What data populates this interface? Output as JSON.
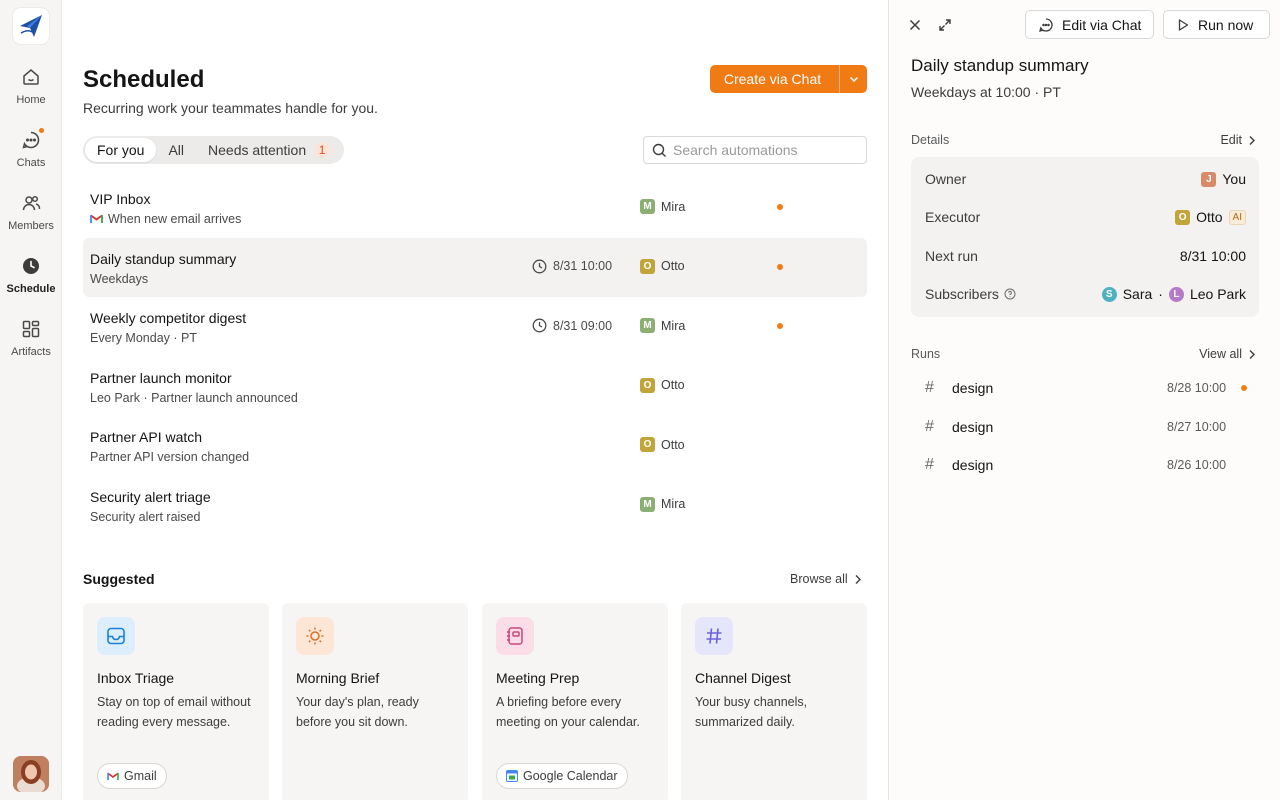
{
  "nav": {
    "items": [
      {
        "label": "Home",
        "icon": "home-icon"
      },
      {
        "label": "Chats",
        "icon": "chat-icon"
      },
      {
        "label": "Members",
        "icon": "members-icon"
      },
      {
        "label": "Schedule",
        "icon": "clock-icon"
      },
      {
        "label": "Artifacts",
        "icon": "artifacts-icon"
      }
    ],
    "active": "Schedule"
  },
  "header": {
    "title": "Scheduled",
    "subtitle": "Recurring work your teammates handle for you.",
    "create_label": "Create via Chat"
  },
  "tabs": [
    {
      "label": "For you"
    },
    {
      "label": "All"
    },
    {
      "label": "Needs attention",
      "count": "1"
    }
  ],
  "search": {
    "placeholder": "Search automations"
  },
  "automations": [
    {
      "name": "VIP Inbox",
      "desc": "When new email arrives",
      "time": "",
      "person": "Mira",
      "initial": "M",
      "dot": true
    },
    {
      "name": "Daily standup summary",
      "desc": "Weekdays",
      "time": "8/31 10:00",
      "person": "Otto",
      "initial": "O",
      "dot": true
    },
    {
      "name": "Weekly competitor digest",
      "desc": "Every Monday · PT",
      "time": "8/31 09:00",
      "person": "Mira",
      "initial": "M",
      "dot": true
    },
    {
      "name": "Partner launch monitor",
      "desc": "Leo Park · Partner launch announced",
      "time": "",
      "person": "Otto",
      "initial": "O",
      "dot": false
    },
    {
      "name": "Partner API watch",
      "desc": "Partner API version changed",
      "time": "",
      "person": "Otto",
      "initial": "O",
      "dot": false
    },
    {
      "name": "Security alert triage",
      "desc": "Security alert raised",
      "time": "",
      "person": "Mira",
      "initial": "M",
      "dot": false
    }
  ],
  "suggested": {
    "title": "Suggested",
    "browse_label": "Browse all",
    "cards": [
      {
        "title": "Inbox Triage",
        "desc": "Stay on top of email without reading every message.",
        "chip": "Gmail"
      },
      {
        "title": "Morning Brief",
        "desc": "Your day's plan, ready before you sit down.",
        "chip": ""
      },
      {
        "title": "Meeting Prep",
        "desc": "A briefing before every meeting on your calendar.",
        "chip": "Google Calendar"
      },
      {
        "title": "Channel Digest",
        "desc": "Your busy channels, summarized daily.",
        "chip": ""
      }
    ]
  },
  "panel": {
    "edit_chat_label": "Edit via Chat",
    "run_now_label": "Run now",
    "title": "Daily standup summary",
    "subtitle": "Weekdays at 10:00 · PT",
    "details_label": "Details",
    "edit_label": "Edit",
    "details": {
      "owner_key": "Owner",
      "owner_initial": "J",
      "owner_val": "You",
      "executor_key": "Executor",
      "executor_initial": "O",
      "executor_val": "Otto",
      "executor_tag": "AI",
      "next_run_key": "Next run",
      "next_run_val": "8/31 10:00",
      "subscribers_key": "Subscribers",
      "sub1_initial": "S",
      "sub1": "Sara",
      "sep": "·",
      "sub2_initial": "L",
      "sub2": "Leo Park"
    },
    "runs_label": "Runs",
    "view_all_label": "View all",
    "runs": [
      {
        "name": "design",
        "time": "8/28 10:00",
        "dot": true
      },
      {
        "name": "design",
        "time": "8/27 10:00",
        "dot": false
      },
      {
        "name": "design",
        "time": "8/26 10:00",
        "dot": false
      }
    ]
  },
  "colors": {
    "accent": "#f07a14",
    "dot": "#f07c14",
    "mira": "#8bae73",
    "otto": "#c2a53a"
  }
}
